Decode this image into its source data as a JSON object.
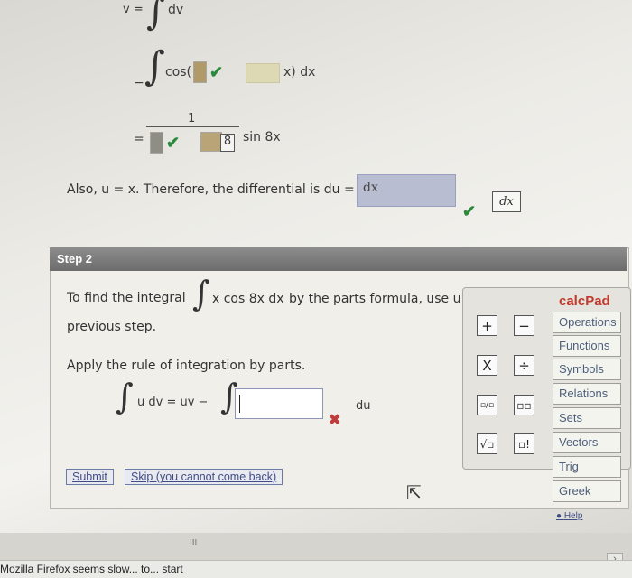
{
  "top": {
    "v_eq": "v =",
    "dv": "dv",
    "line2_prefix": "−",
    "cos_open": "cos(",
    "line2_suffix": "x) dx",
    "eq": "=",
    "numerator": "1",
    "den_box": "8",
    "sin_term": "sin 8x",
    "also_text": "Also, u = x. Therefore, the differential is du =",
    "du_answer": "dx",
    "dx_key": "dx"
  },
  "step2": {
    "header": "Step 2",
    "find_prefix": "To find the integral",
    "integrand": "x cos 8x dx",
    "find_suffix": "by the parts formula, use u",
    "previous": "previous step.",
    "apply": "Apply the rule of integration by parts.",
    "formula_left": "u dv = uv −",
    "answer_value": "",
    "du_label": "du",
    "submit": "Submit",
    "skip": "Skip (you cannot come back)"
  },
  "calcpad": {
    "title": "calcPad",
    "categories": [
      "Operations",
      "Functions",
      "Symbols",
      "Relations",
      "Sets",
      "Vectors",
      "Trig",
      "Greek"
    ],
    "help": "Help",
    "keys": [
      "+",
      "−",
      "X",
      "÷",
      "▫/▫",
      "▫▫",
      "√▫",
      "▫!"
    ]
  },
  "status": {
    "text": "Mozilla Firefox seems slow... to... start",
    "scroll_grip": "III"
  },
  "colors": {
    "accent": "#c03b3b",
    "check": "#2a8a3a",
    "link": "#3f4c86",
    "header": "#7a7a7a"
  }
}
